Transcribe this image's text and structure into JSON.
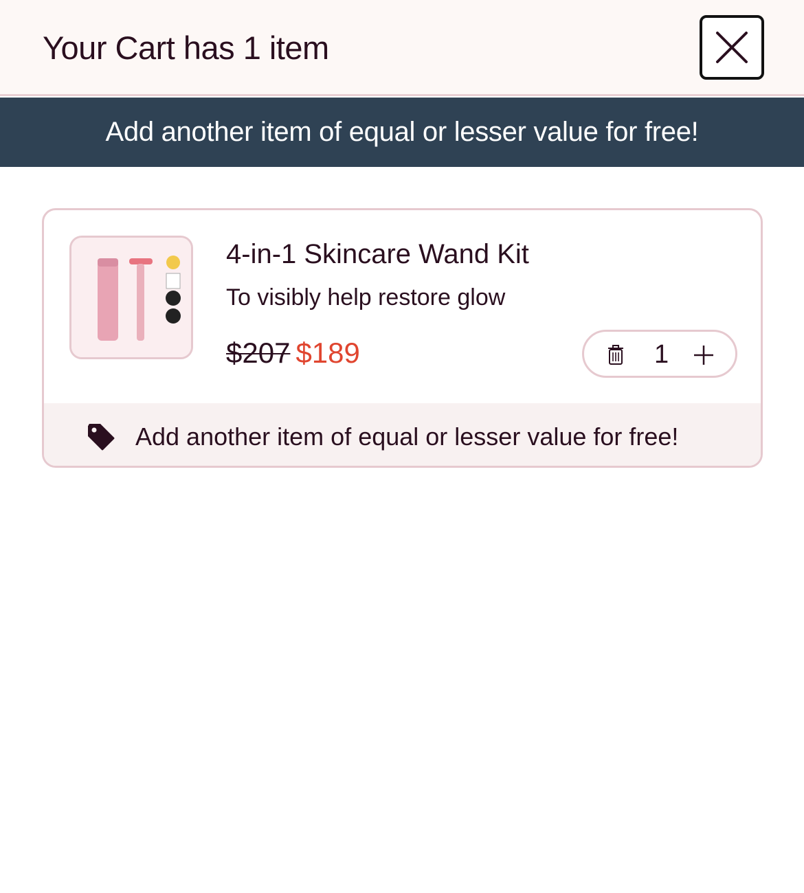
{
  "header": {
    "title": "Your Cart has 1 item",
    "close_icon": "close-icon"
  },
  "promo_banner": {
    "text": "Add another item of equal or lesser value for free!",
    "background": "#2f4254"
  },
  "cart": {
    "items": [
      {
        "name": "4-in-1 Skincare Wand Kit",
        "subtitle": "To visibly help restore glow",
        "original_price": "$207",
        "sale_price": "$189",
        "quantity": "1",
        "thumbnail_icon": "product-image"
      }
    ],
    "footer_note": "Add another item of equal or lesser value for free!",
    "footer_icon": "tag-icon"
  },
  "colors": {
    "sale_price": "#e0452f",
    "text": "#2a0f1f",
    "border": "#e6c9cf"
  }
}
